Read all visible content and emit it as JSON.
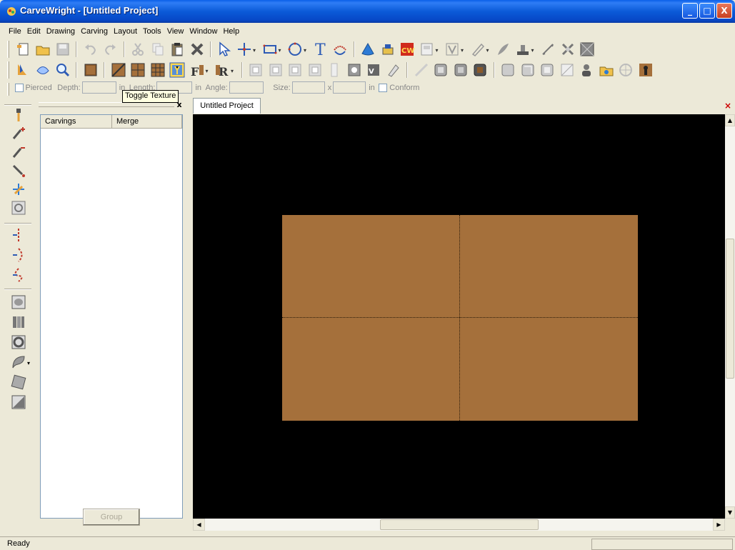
{
  "window": {
    "title": "CarveWright - [Untitled Project]",
    "minimize_glyph": "_",
    "maximize_glyph": "□",
    "close_glyph": "X"
  },
  "menu": [
    "File",
    "Edit",
    "Drawing",
    "Carving",
    "Layout",
    "Tools",
    "View",
    "Window",
    "Help"
  ],
  "properties": {
    "pierced_label": "Pierced",
    "depth_label": "Depth:",
    "unit1": "in",
    "length_label": "Length:",
    "unit2": "in",
    "angle_label": "Angle:",
    "size_label": "Size:",
    "size_x": "x",
    "unit3": "in",
    "conform_label": "Conform"
  },
  "tooltip": "Toggle Texture",
  "panel": {
    "close_glyph": "x",
    "columns": [
      "Carvings",
      "Merge"
    ],
    "group_label": "Group"
  },
  "document": {
    "tab_label": "Untitled Project",
    "close_glyph": "×"
  },
  "status": {
    "text": "Ready"
  },
  "colors": {
    "board": "#a5703b",
    "canvas_bg": "#000000",
    "title_bar": "#0a5fe8"
  }
}
